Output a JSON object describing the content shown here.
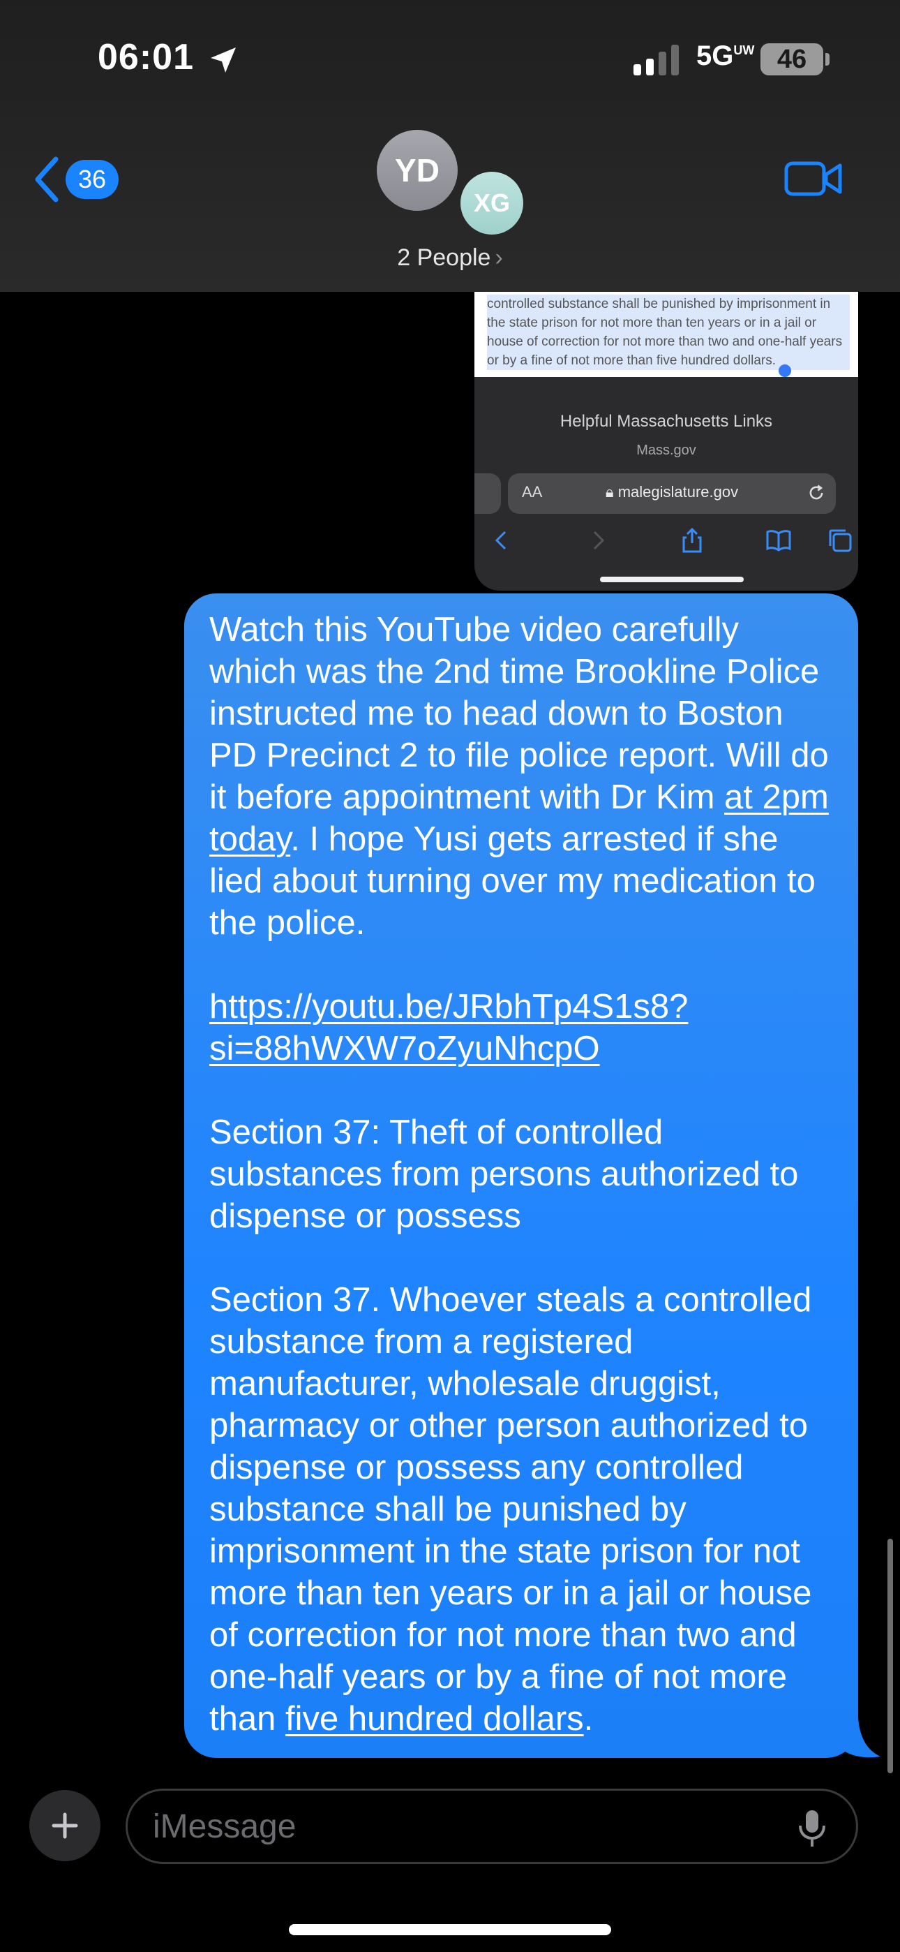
{
  "status_bar": {
    "time": "06:01",
    "network": "5G",
    "network_sup": "UW",
    "battery": "46"
  },
  "nav": {
    "back_count": "36",
    "avatars": [
      "YD",
      "XG"
    ],
    "title": "2 People"
  },
  "screenshot": {
    "doc_lines": [
      "controlled substance shall be punished by imprisonment in",
      "the state prison for not more than ten years or in a jail or",
      "house of correction for not more than two and one-half years",
      "or by a fine of not more than five hundred dollars."
    ],
    "footer_title": "Helpful Massachusetts Links",
    "footer_subtitle": "Mass.gov",
    "text_size_label": "AA",
    "url": "malegislature.gov"
  },
  "message": {
    "para1_before": "Watch this YouTube video carefully which was the 2nd time Brookline Police instructed me to head down to Boston PD Precinct 2 to file police report. Will do it before appointment with Dr Kim ",
    "para1_link": "at 2pm today",
    "para1_after": ". I hope Yusi gets arrested if she lied about turning over my medication to the police.",
    "link_url": "https://youtu.be/JRbhTp4S1s8?si=88hWXW7oZyuNhcpO",
    "para3": "Section 37: Theft of controlled substances from persons authorized to dispense or possess",
    "para4_before": "Section 37. Whoever steals a controlled substance from a registered manufacturer, wholesale druggist, pharmacy or other person authorized to dispense or possess any controlled substance shall be punished by imprisonment in the state prison for not more than ten years or in a jail or house of correction for not more than two and one-half years or by a fine of not more than ",
    "para4_link": "five hundred dollars",
    "para4_after": "."
  },
  "compose": {
    "placeholder": "iMessage"
  },
  "colors": {
    "bubble": "#1f84ff",
    "accent": "#1a84ff",
    "background": "#000000"
  }
}
